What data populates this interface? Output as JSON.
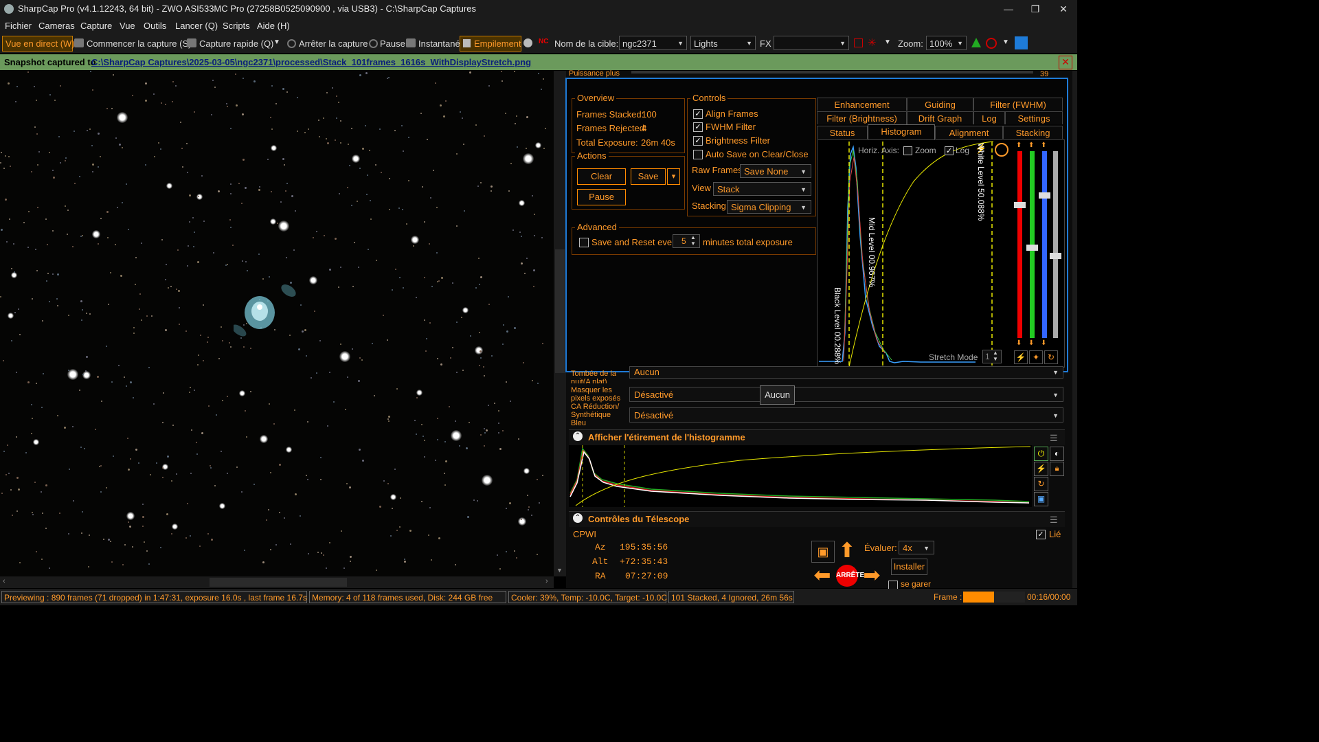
{
  "window": {
    "title": "SharpCap Pro (v4.1.12243, 64 bit) - ZWO ASI533MC Pro (27258B0525090900 , via USB3) - C:\\SharpCap Captures",
    "minimize": "—",
    "maximize": "❐",
    "close": "✕"
  },
  "menu": [
    "Fichier",
    "Cameras",
    "Capture",
    "Vue",
    "Outils",
    "Lancer (Q)",
    "Scripts",
    "Aide (H)"
  ],
  "toolbar": {
    "live_view": "Vue en direct (W)",
    "start_capture": "Commencer la capture (S)",
    "quick_capture": "Capture rapide (Q)",
    "stop_capture": "Arrêter la capture",
    "pause": "Pause",
    "snapshot": "Instantané",
    "stacking": "Empilement",
    "target_label": "Nom de la cible:",
    "target_value": "ngc2371",
    "frame_type": "Lights",
    "fx_label": "FX",
    "fx_value": "",
    "zoom_label": "Zoom:",
    "zoom_value": "100%"
  },
  "notification": {
    "prefix": "Snapshot captured to",
    "path": "C:\\SharpCap Captures\\2025-03-05\\ngc2371\\processed\\Stack_101frames_1616s_WithDisplayStretch.png",
    "close": "✕"
  },
  "behind_panel": {
    "label": "Puissance plus",
    "value": "39"
  },
  "stacking": {
    "overview": {
      "title": "Overview",
      "frames_stacked_label": "Frames Stacked:",
      "frames_stacked": "100",
      "frames_rejected_label": "Frames Rejected:",
      "frames_rejected": "4",
      "total_exposure_label": "Total Exposure:",
      "total_exposure": "26m 40s"
    },
    "actions": {
      "title": "Actions",
      "clear": "Clear",
      "save": "Save",
      "save_arrow": "▾",
      "pause": "Pause"
    },
    "controls": {
      "title": "Controls",
      "align_frames": "Align Frames",
      "align_frames_checked": true,
      "fwhm_filter": "FWHM Filter",
      "fwhm_filter_checked": true,
      "brightness_filter": "Brightness Filter",
      "brightness_filter_checked": true,
      "auto_save": "Auto Save on Clear/Close",
      "auto_save_checked": false,
      "raw_frames_label": "Raw Frames",
      "raw_frames_value": "Save None",
      "view_label": "View",
      "view_value": "Stack",
      "stacking_label": "Stacking",
      "stacking_value": "Sigma Clipping"
    },
    "advanced": {
      "title": "Advanced",
      "save_reset_label": "Save and Reset every",
      "minutes_value": "5",
      "minutes_suffix": "minutes total exposure"
    },
    "tabs_row1": [
      "Enhancement",
      "Guiding",
      "Filter (FWHM)"
    ],
    "tabs_row2": [
      "Filter (Brightness)",
      "Drift Graph",
      "Log",
      "Settings"
    ],
    "tabs_row3": [
      "Status",
      "Histogram",
      "Alignment",
      "Stacking"
    ],
    "selected_tab": "Histogram",
    "histogram": {
      "horiz_axis_label": "Horiz. Axis:",
      "zoom_label": "Zoom",
      "log_label": "Log",
      "black_level": "Black Level  00.288%",
      "mid_level": "Mid Level  00.967%",
      "white_level": "White Level  50.088%",
      "stretch_mode_label": "Stretch Mode",
      "stretch_mode_value": "1"
    }
  },
  "lower_settings": [
    {
      "label": "Tombée de la nuit(A plat)",
      "value": "Aucun"
    },
    {
      "label": "Masquer les pixels exposés",
      "value": "Désactivé",
      "tooltip": "Aucun"
    },
    {
      "label": "CA Réduction/ Synthétique Bleu",
      "value": "Désactivé"
    }
  ],
  "histogram_panel": {
    "title": "Afficher l'étirement de l'histogramme"
  },
  "telescope": {
    "title": "Contrôles du Télescope",
    "mount": "CPWI",
    "linked_label": "Lié",
    "az_label": "Az",
    "az": "195:35:56",
    "alt_label": "Alt",
    "alt": "+72:35:43",
    "ra_label": "RA",
    "ra": "07:27:09",
    "stop_label": "ARRÊTE",
    "rate_label": "Évaluer:",
    "rate_value": "4x",
    "setup_button": "Installer",
    "park_label": "se garer"
  },
  "status": {
    "preview": "Previewing : 890 frames (71 dropped) in 1:47:31, exposure 16.0s , last frame 16.7s",
    "memory": "Memory: 4 of 118 frames used, Disk: 244 GB free",
    "cooler": "Cooler: 39%, Temp: -10.0C, Target: -10.0C",
    "stacked": "101 Stacked, 4 Ignored, 26m 56s",
    "frame_label": "Frame :",
    "frame_time": "00:16/00:00",
    "frame_progress": 0.5
  },
  "colors": {
    "accent_orange": "#ff9a2a",
    "highlight_blue": "#1e7bd8",
    "notify_green": "#6b9a5c"
  }
}
